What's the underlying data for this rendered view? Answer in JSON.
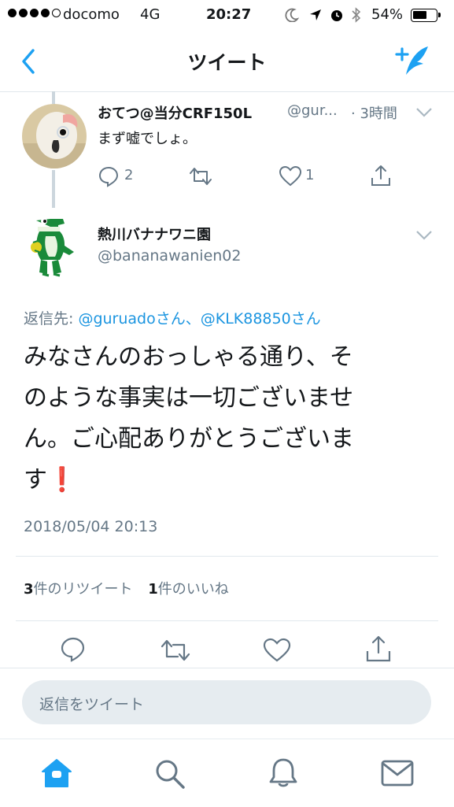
{
  "status_bar": {
    "carrier": "docomo",
    "network": "4G",
    "time": "20:27",
    "battery": "54%",
    "signal_bars": 4
  },
  "nav": {
    "title": "ツイート"
  },
  "prev_tweet": {
    "name": "おてつ@当分CRF150L",
    "handle": "@gur...",
    "time": "· 3時間",
    "text": "まず嘘でしょ。",
    "reply_count": "2",
    "like_count": "1"
  },
  "main_tweet": {
    "name": "熱川バナナワニ園",
    "handle": "@bananawanien02",
    "reply_to_label": "返信先: ",
    "reply_to_users": "@guruadoさん、@KLK88850さん",
    "lines": [
      "みなさんのおっしゃる通り、そ",
      "のような事実は一切ございませ",
      "ん。ご心配ありがとうございま",
      "す"
    ],
    "emoji": "❗",
    "timestamp": "2018/05/04 20:13",
    "retweet_count": "3",
    "retweet_label": "件のリツイート",
    "like_count": "1",
    "like_label": "件のいいね"
  },
  "reply_box": {
    "placeholder": "返信をツイート"
  },
  "icons": {
    "accent": "#1da1f2",
    "muted": "#657786",
    "names": [
      "back-chevron-icon",
      "compose-tweet-icon",
      "reply-icon",
      "retweet-icon",
      "like-icon",
      "share-icon",
      "home-icon",
      "search-icon",
      "notifications-icon",
      "messages-icon"
    ]
  }
}
